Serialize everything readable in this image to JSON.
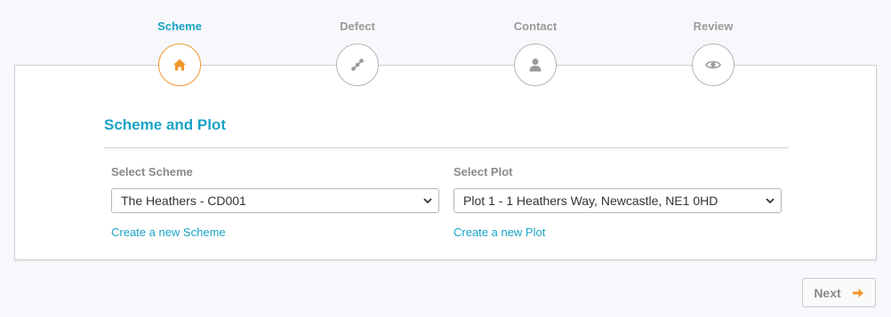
{
  "steps": [
    {
      "label": "Scheme",
      "icon": "home-icon",
      "active": true
    },
    {
      "label": "Defect",
      "icon": "link-icon",
      "active": false
    },
    {
      "label": "Contact",
      "icon": "user-icon",
      "active": false
    },
    {
      "label": "Review",
      "icon": "eye-icon",
      "active": false
    }
  ],
  "section": {
    "title": "Scheme and Plot"
  },
  "scheme": {
    "label": "Select Scheme",
    "selected": "The Heathers - CD001",
    "create_link": "Create a new Scheme"
  },
  "plot": {
    "label": "Select Plot",
    "selected": "Plot 1 - 1 Heathers Way, Newcastle, NE1 0HD",
    "create_link": "Create a new Plot"
  },
  "footer": {
    "next_label": "Next"
  },
  "colors": {
    "accent": "#1aa3c5",
    "active_step": "#f1962e",
    "inactive": "#9a9a9a"
  }
}
